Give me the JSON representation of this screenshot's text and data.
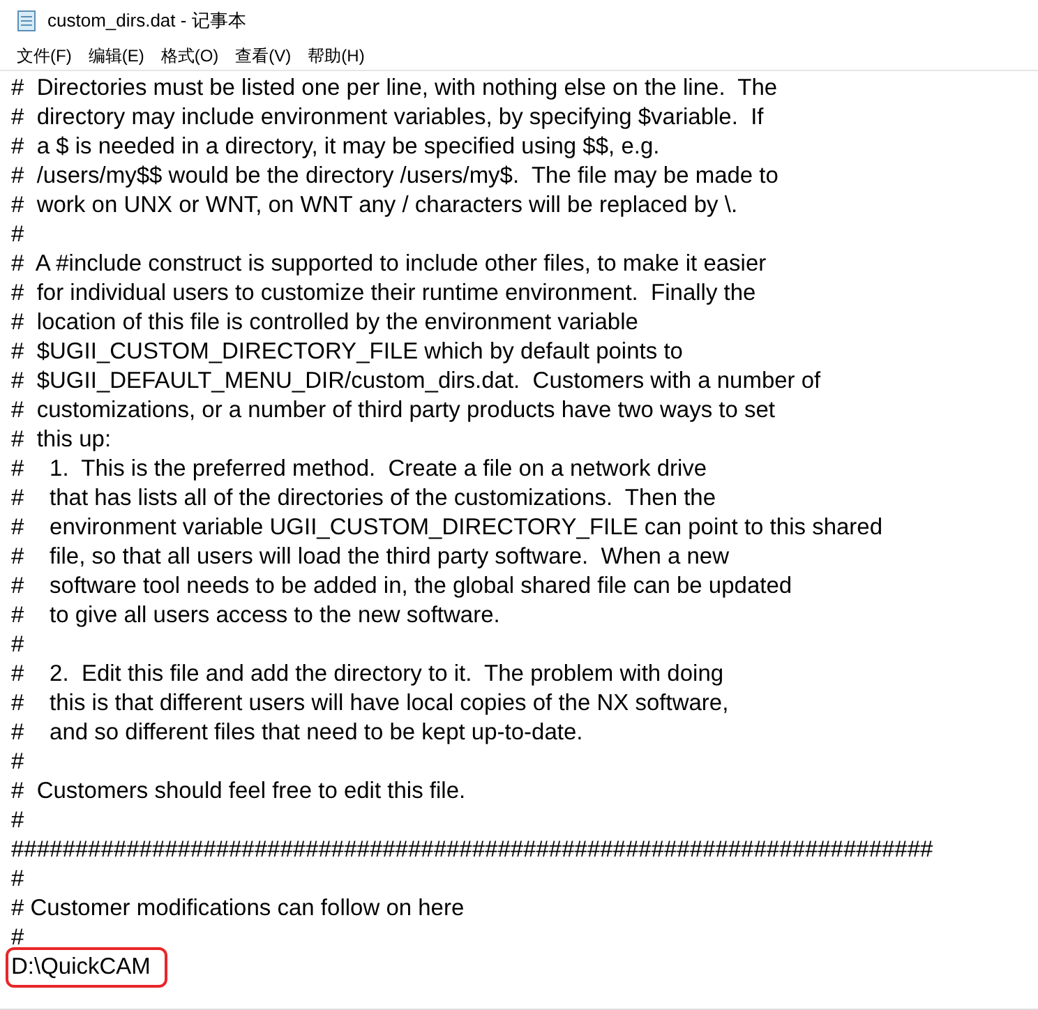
{
  "window": {
    "title": "custom_dirs.dat - 记事本"
  },
  "menu": [
    "文件(F)",
    "编辑(E)",
    "格式(O)",
    "查看(V)",
    "帮助(H)"
  ],
  "lines": [
    {
      "text": "#  Directories must be listed one per line, with nothing else on the line.  The",
      "highlighted": false
    },
    {
      "text": "#  directory may include environment variables, by specifying $variable.  If",
      "highlighted": false
    },
    {
      "text": "#  a $ is needed in a directory, it may be specified using $$, e.g.",
      "highlighted": false
    },
    {
      "text": "#  /users/my$$ would be the directory /users/my$.  The file may be made to",
      "highlighted": false
    },
    {
      "text": "#  work on UNX or WNT, on WNT any / characters will be replaced by \\.",
      "highlighted": false
    },
    {
      "text": "#",
      "highlighted": false
    },
    {
      "text": "#  A #include construct is supported to include other files, to make it easier",
      "highlighted": false
    },
    {
      "text": "#  for individual users to customize their runtime environment.  Finally the",
      "highlighted": false
    },
    {
      "text": "#  location of this file is controlled by the environment variable",
      "highlighted": false
    },
    {
      "text": "#  $UGII_CUSTOM_DIRECTORY_FILE which by default points to",
      "highlighted": false
    },
    {
      "text": "#  $UGII_DEFAULT_MENU_DIR/custom_dirs.dat.  Customers with a number of",
      "highlighted": false
    },
    {
      "text": "#  customizations, or a number of third party products have two ways to set",
      "highlighted": false
    },
    {
      "text": "#  this up:",
      "highlighted": false
    },
    {
      "text": "#    1.  This is the preferred method.  Create a file on a network drive",
      "highlighted": false
    },
    {
      "text": "#    that has lists all of the directories of the customizations.  Then the",
      "highlighted": false
    },
    {
      "text": "#    environment variable UGII_CUSTOM_DIRECTORY_FILE can point to this shared",
      "highlighted": false
    },
    {
      "text": "#    file, so that all users will load the third party software.  When a new",
      "highlighted": false
    },
    {
      "text": "#    software tool needs to be added in, the global shared file can be updated",
      "highlighted": false
    },
    {
      "text": "#    to give all users access to the new software.",
      "highlighted": false
    },
    {
      "text": "#",
      "highlighted": false
    },
    {
      "text": "#    2.  Edit this file and add the directory to it.  The problem with doing",
      "highlighted": false
    },
    {
      "text": "#    this is that different users will have local copies of the NX software,",
      "highlighted": false
    },
    {
      "text": "#    and so different files that need to be kept up-to-date.",
      "highlighted": false
    },
    {
      "text": "#",
      "highlighted": false
    },
    {
      "text": "#  Customers should feel free to edit this file.",
      "highlighted": false
    },
    {
      "text": "#",
      "highlighted": false
    },
    {
      "text": "########################################################################",
      "highlighted": false
    },
    {
      "text": "#",
      "highlighted": false
    },
    {
      "text": "# Customer modifications can follow on here",
      "highlighted": false
    },
    {
      "text": "#",
      "highlighted": false
    },
    {
      "text": "D:\\QuickCAM",
      "highlighted": true
    }
  ]
}
